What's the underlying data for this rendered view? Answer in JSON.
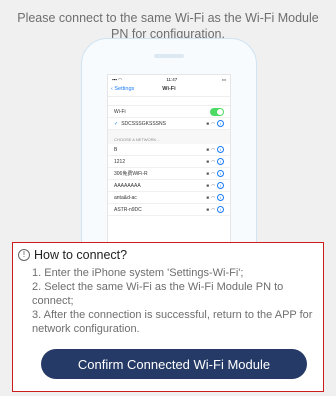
{
  "instruction": "Please connect to the same Wi-Fi as the Wi-Fi Module PN for configuration.",
  "phone": {
    "status_time": "11:47",
    "nav_back": "Settings",
    "nav_title": "Wi-Fi",
    "wifi_label": "Wi-Fi",
    "connected_network": "SDCSSSGKSSSNS",
    "section_header": "CHOOSE A NETWORK...",
    "networks": [
      "B",
      "1212",
      "306免费WiFi-R",
      "AAAAAAAA",
      "anta&d-ac",
      "ASTR-n9DC"
    ]
  },
  "dialog": {
    "title": "How to connect?",
    "steps": [
      "1. Enter the iPhone system 'Settings-Wi-Fi';",
      "2. Select the same Wi-Fi as the Wi-Fi Module PN to connect;",
      "3. After the connection is successful, return to the APP for network configuration."
    ],
    "button_label": "Confirm Connected Wi-Fi Module"
  },
  "colors": {
    "button_bg": "#253a66",
    "dialog_border": "#cc1c1c",
    "toggle_on": "#4cd964",
    "ios_blue": "#1a7bf5"
  }
}
